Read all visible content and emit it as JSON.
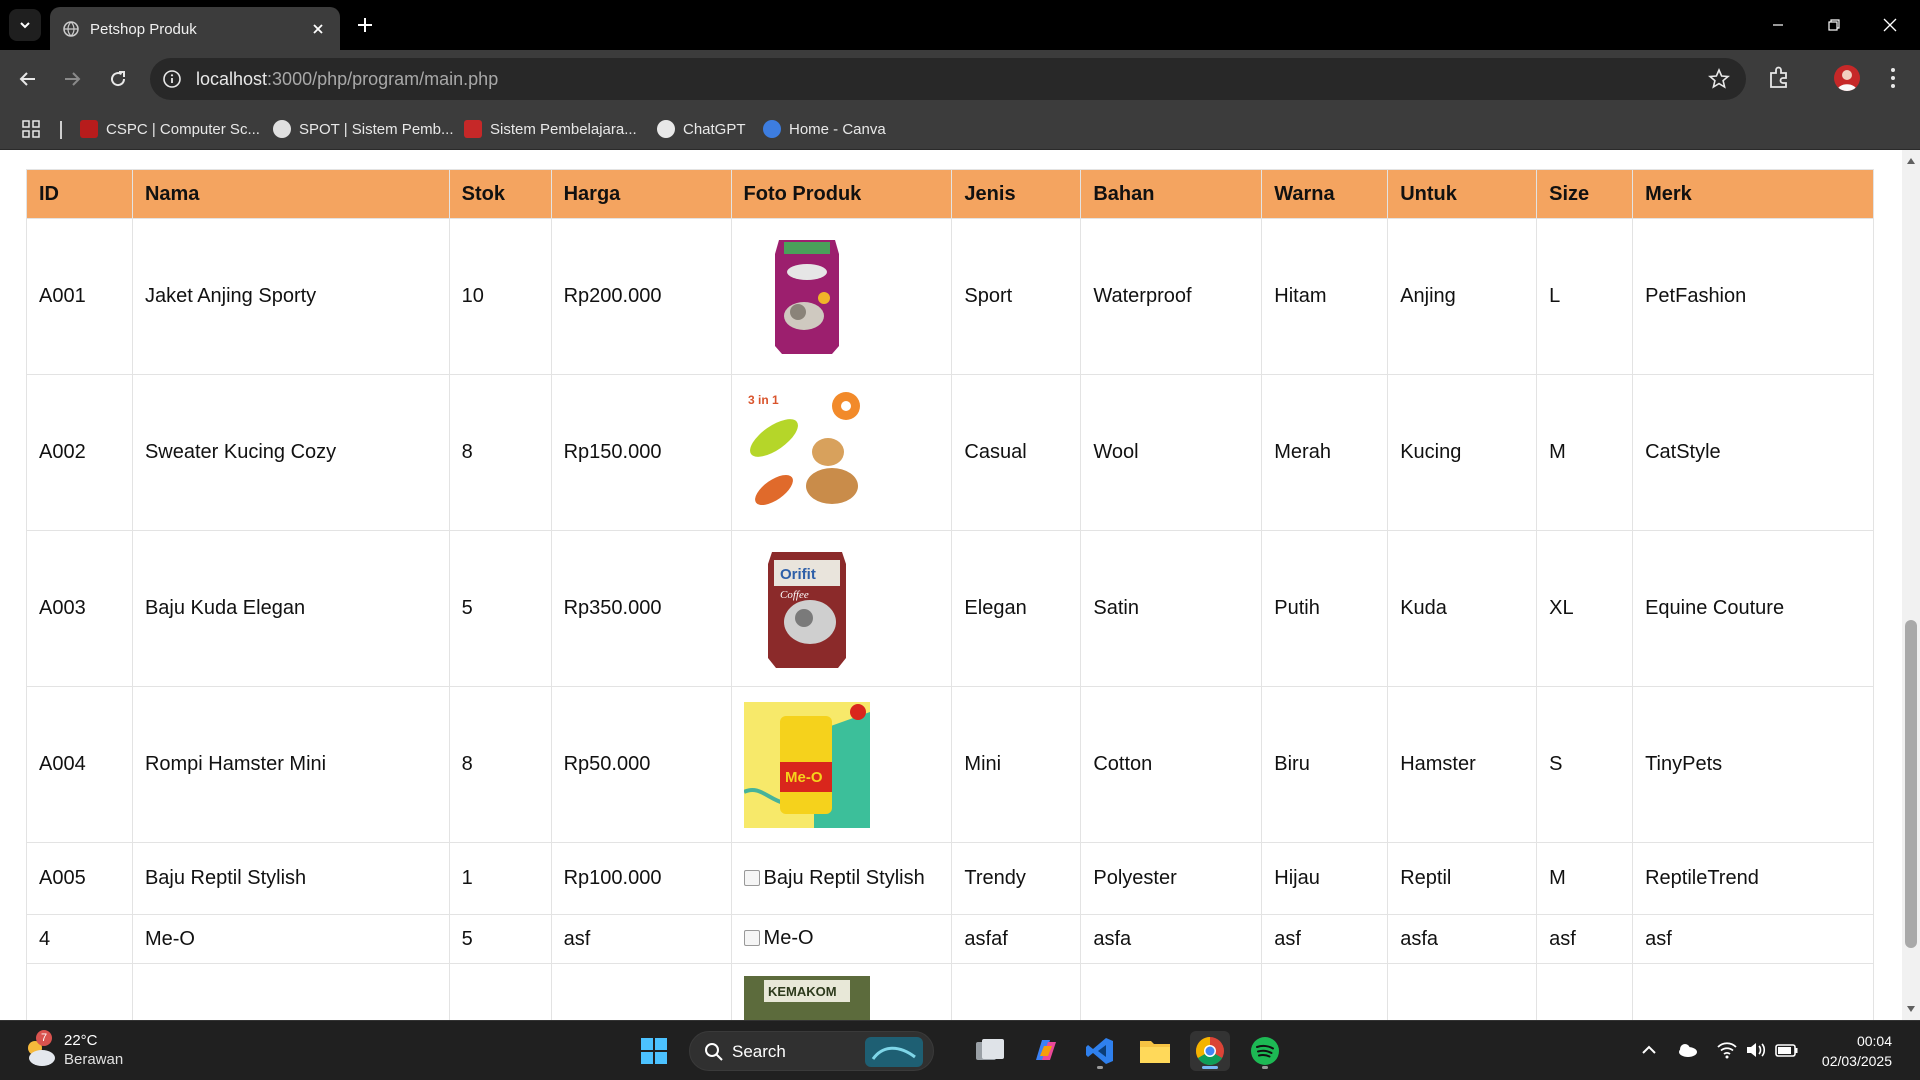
{
  "browser": {
    "tab_title": "Petshop Produk",
    "url_host": "localhost",
    "url_rest": ":3000/php/program/main.php",
    "bookmarks": [
      {
        "label": "CSPC | Computer Sc..."
      },
      {
        "label": "SPOT | Sistem Pemb..."
      },
      {
        "label": "Sistem Pembelajara..."
      },
      {
        "label": "ChatGPT"
      },
      {
        "label": "Home - Canva"
      }
    ]
  },
  "table": {
    "headers": [
      "ID",
      "Nama",
      "Stok",
      "Harga",
      "Foto Produk",
      "Jenis",
      "Bahan",
      "Warna",
      "Untuk",
      "Size",
      "Merk"
    ],
    "rows": [
      {
        "id": "A001",
        "nama": "Jaket Anjing Sporty",
        "stok": "10",
        "harga": "Rp200.000",
        "foto": "whiskas-cat-food-bag",
        "jenis": "Sport",
        "bahan": "Waterproof",
        "warna": "Hitam",
        "untuk": "Anjing",
        "size": "L",
        "merk": "PetFashion"
      },
      {
        "id": "A002",
        "nama": "Sweater Kucing Cozy",
        "stok": "8",
        "harga": "Rp150.000",
        "foto": "dog-brush-3in1",
        "foto_text": "3 in 1",
        "jenis": "Casual",
        "bahan": "Wool",
        "warna": "Merah",
        "untuk": "Kucing",
        "size": "M",
        "merk": "CatStyle"
      },
      {
        "id": "A003",
        "nama": "Baju Kuda Elegan",
        "stok": "5",
        "harga": "Rp350.000",
        "foto": "orifit-cat-litter-bag",
        "foto_text": "Orifit",
        "foto_sub": "Coffee",
        "jenis": "Elegan",
        "bahan": "Satin",
        "warna": "Putih",
        "untuk": "Kuda",
        "size": "XL",
        "merk": "Equine Couture"
      },
      {
        "id": "A004",
        "nama": "Rompi Hamster Mini",
        "stok": "8",
        "harga": "Rp50.000",
        "foto": "me-o-can",
        "foto_text": "Me-O",
        "jenis": "Mini",
        "bahan": "Cotton",
        "warna": "Biru",
        "untuk": "Hamster",
        "size": "S",
        "merk": "TinyPets"
      },
      {
        "id": "A005",
        "nama": "Baju Reptil Stylish",
        "stok": "1",
        "harga": "Rp100.000",
        "foto_alt": "Baju Reptil Stylish",
        "jenis": "Trendy",
        "bahan": "Polyester",
        "warna": "Hijau",
        "untuk": "Reptil",
        "size": "M",
        "merk": "ReptileTrend"
      },
      {
        "id": "4",
        "nama": "Me-O",
        "stok": "5",
        "harga": "asf",
        "foto_alt": "Me-O",
        "jenis": "asfaf",
        "bahan": "asfa",
        "warna": "asf",
        "untuk": "asfa",
        "size": "asf",
        "merk": "asf"
      },
      {
        "id": "",
        "nama": "",
        "stok": "",
        "harga": "",
        "foto": "kemakom-product",
        "foto_text": "KEMAKOM",
        "jenis": "",
        "bahan": "",
        "warna": "",
        "untuk": "",
        "size": "",
        "merk": ""
      }
    ]
  },
  "taskbar": {
    "weather_temp": "22°C",
    "weather_desc": "Berawan",
    "weather_badge": "7",
    "search_label": "Search",
    "time": "00:04",
    "date": "02/03/2025"
  },
  "colors": {
    "header_bg": "#f4a460",
    "chrome_bg": "#3c3c3c",
    "tabbar_bg": "#000000",
    "taskbar_bg": "#202020"
  }
}
